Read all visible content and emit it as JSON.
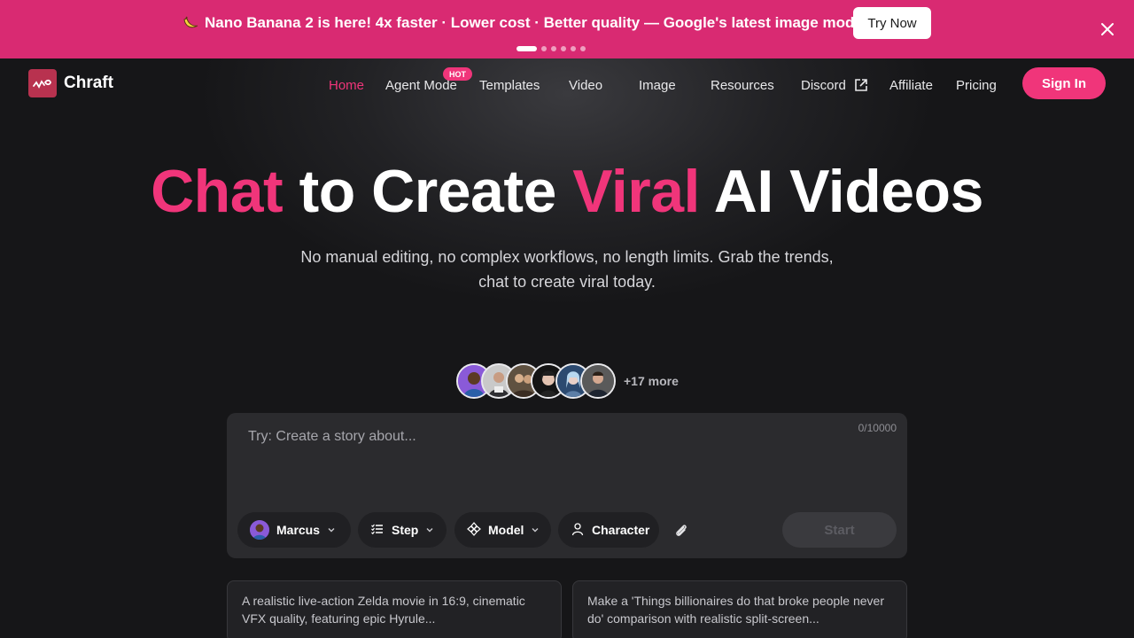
{
  "announcement": {
    "icon": "banana-icon",
    "text": "Nano Banana 2 is here! 4x faster · Lower cost · Better quality — Google's latest image model.",
    "cta": "Try Now",
    "slides_total": 6,
    "slide_active": 1
  },
  "nav": {
    "logo": "Chraft",
    "items": [
      {
        "label": "Home",
        "active": true
      },
      {
        "label": "Agent Mode",
        "badge": "HOT"
      },
      {
        "label": "Templates"
      },
      {
        "label": "Video"
      },
      {
        "label": "Image"
      },
      {
        "label": "Resources"
      },
      {
        "label": "Discord",
        "icon": "external-link-icon"
      },
      {
        "label": "Affiliate"
      },
      {
        "label": "Pricing"
      }
    ],
    "sign_in": "Sign In"
  },
  "hero": {
    "title_parts": [
      "Chat",
      " to Create ",
      "Viral",
      " AI Videos"
    ],
    "subtitle_line1": "No manual editing, no complex workflows, no length limits. Grab the trends,",
    "subtitle_line2": "chat to create viral today."
  },
  "characters": {
    "more_text": "+17 more"
  },
  "composer": {
    "placeholder": "Try: Create a story about...",
    "counter": "0/10000",
    "chips": {
      "character_select": "Marcus",
      "step": "Step",
      "model": "Model",
      "character": "Character"
    },
    "start": "Start"
  },
  "suggestions": [
    "A realistic live-action Zelda movie in 16:9, cinematic VFX quality, featuring epic Hyrule...",
    "Make a 'Things billionaires do that broke people never do' comparison with realistic split-screen..."
  ],
  "colors": {
    "accent": "#f0357a",
    "banner": "#d92a72",
    "background": "#141416"
  }
}
